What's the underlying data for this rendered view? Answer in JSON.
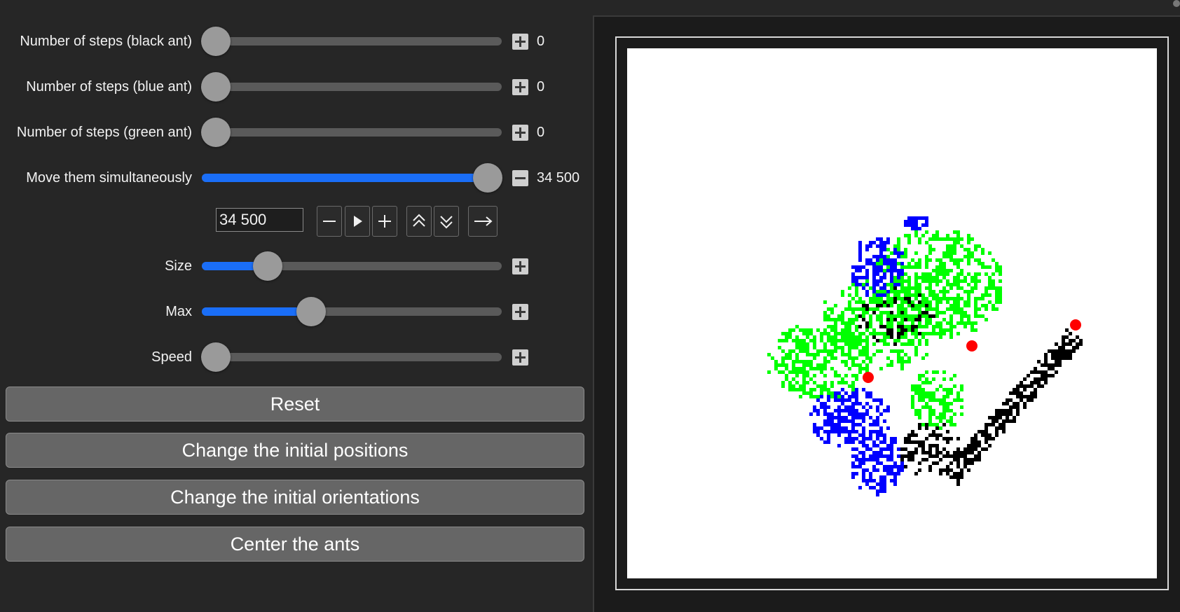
{
  "sliders": [
    {
      "label": "Number of steps (black ant)",
      "value": "0",
      "fraction": 0.0,
      "filled": false,
      "button": "plus-button"
    },
    {
      "label": "Number of steps (blue ant)",
      "value": "0",
      "fraction": 0.0,
      "filled": false,
      "button": "plus-button"
    },
    {
      "label": "Number of steps (green ant)",
      "value": "0",
      "fraction": 0.0,
      "filled": false,
      "button": "plus-button"
    },
    {
      "label": "Move them simultaneously",
      "value": "34 500",
      "fraction": 1.0,
      "filled": true,
      "button": "minus-button"
    }
  ],
  "controls": {
    "step_input": "34 500",
    "buttons": [
      "minus-icon",
      "play-icon",
      "plus-icon",
      "double-chevron-up-icon",
      "double-chevron-down-icon",
      "arrow-right-icon"
    ]
  },
  "params": [
    {
      "label": "Size",
      "fraction": 0.19,
      "filled": true
    },
    {
      "label": "Max",
      "fraction": 0.35,
      "filled": true
    },
    {
      "label": "Speed",
      "fraction": 0.0,
      "filled": false
    }
  ],
  "actions": {
    "reset": "Reset",
    "change_positions": "Change the initial positions",
    "change_orientations": "Change the initial orientations",
    "center": "Center the ants"
  },
  "colors": {
    "accent": "#1a6ef7",
    "background": "#262626",
    "black_ant_trail": "#000000",
    "blue_ant_trail": "#0000ff",
    "green_ant_trail": "#00ff00",
    "ant_marker": "#ff0000"
  }
}
